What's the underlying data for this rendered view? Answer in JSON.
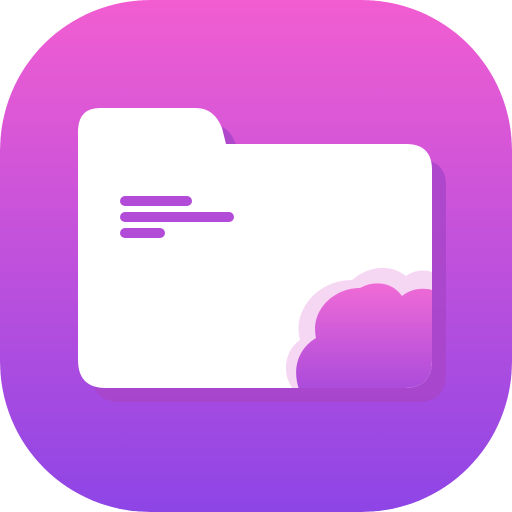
{
  "icon": {
    "name": "cloud-folder-app-icon",
    "depicts": "folder-with-cloud",
    "colors": {
      "background_top": "#F25DD1",
      "background_bottom": "#8E45E6",
      "folder": "#FFFFFF",
      "folder_shadow": "#A845C9",
      "cloud_top": "#F06BD6",
      "cloud_bottom": "#A94ADB",
      "cloud_halo": "#F6D7F3",
      "text_lines": "#B14BD8"
    }
  }
}
